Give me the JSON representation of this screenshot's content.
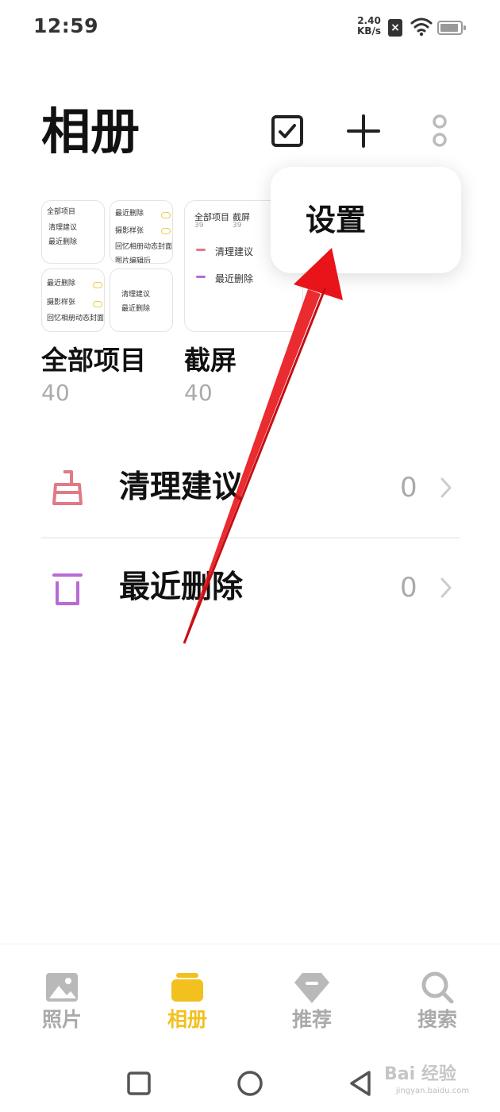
{
  "status_bar": {
    "time": "12:59",
    "net_speed_value": "2.40",
    "net_speed_unit": "KB/s",
    "sim_status": "×",
    "icons": [
      "sim-off-icon",
      "wifi-icon",
      "battery-icon"
    ]
  },
  "header": {
    "title": "相册",
    "actions": [
      "select-icon",
      "add-icon",
      "more-icon"
    ]
  },
  "popup_menu": {
    "items": [
      {
        "label": "设置"
      }
    ]
  },
  "albums": [
    {
      "name": "全部项目",
      "count": "40"
    },
    {
      "name": "截屏",
      "count": "40"
    }
  ],
  "thumb_text": {
    "all_items": "全部项目",
    "screenshots": "截屏",
    "count_39": "39",
    "clean": "清理建议",
    "deleted": "最近删除",
    "photo_style": "摄影样张",
    "memory_cover": "回忆相册动态封面",
    "photo_edit": "图片编辑后"
  },
  "list": [
    {
      "label": "清理建议",
      "count": "0",
      "icon": "broom-icon"
    },
    {
      "label": "最近删除",
      "count": "0",
      "icon": "trash-icon"
    }
  ],
  "bottom_nav": [
    {
      "label": "照片",
      "icon": "image-icon",
      "active": false
    },
    {
      "label": "相册",
      "icon": "album-icon",
      "active": true
    },
    {
      "label": "推荐",
      "icon": "diamond-icon",
      "active": false
    },
    {
      "label": "搜索",
      "icon": "search-icon",
      "active": false
    }
  ],
  "system_nav": [
    "recent-apps-icon",
    "home-icon",
    "back-icon"
  ],
  "colors": {
    "accent": "#f2c01f",
    "clean_icon": "#e07a85",
    "trash_icon": "#b86ad6",
    "annotation_arrow": "#e8141a"
  },
  "watermark": {
    "logo": "Bai 经验",
    "url": "jingyan.baidu.com"
  }
}
